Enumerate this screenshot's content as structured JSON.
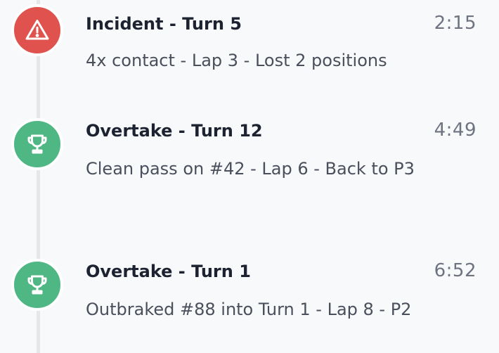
{
  "colors": {
    "incident": "#e0524d",
    "overtake": "#4fb783",
    "rail": "#e6e7ea",
    "background": "#f8f9fb"
  },
  "events": [
    {
      "type": "incident",
      "icon": "warning-icon",
      "title": "Incident - Turn 5",
      "time": "2:15",
      "description": "4x contact - Lap 3 - Lost 2 positions"
    },
    {
      "type": "overtake",
      "icon": "trophy-icon",
      "title": "Overtake - Turn 12",
      "time": "4:49",
      "description": "Clean pass on #42 - Lap 6 - Back to P3"
    },
    {
      "type": "overtake",
      "icon": "trophy-icon",
      "title": "Overtake - Turn 1",
      "time": "6:52",
      "description": "Outbraked #88 into Turn 1 - Lap 8 - P2"
    }
  ]
}
